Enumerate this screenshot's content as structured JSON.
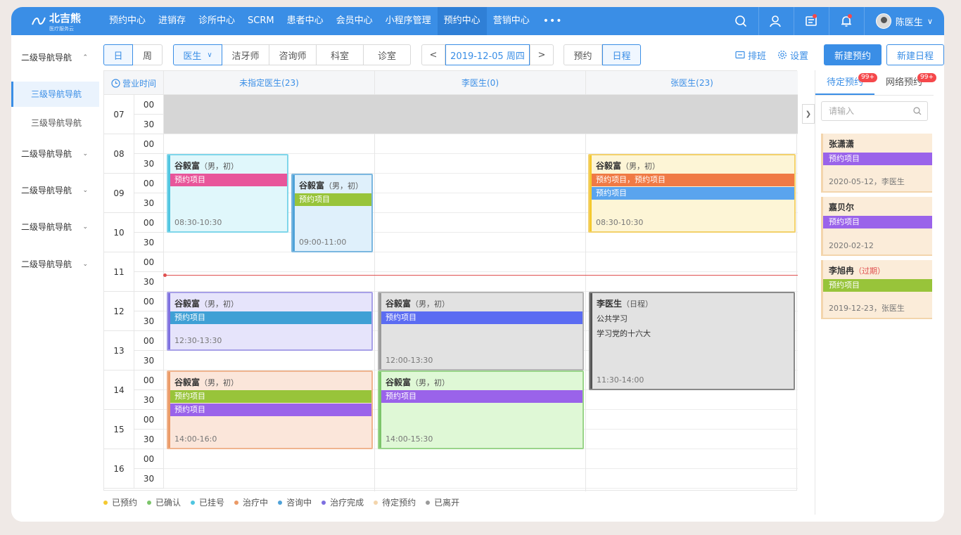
{
  "brand": {
    "name": "北吉熊",
    "sub": "医疗服务云"
  },
  "nav": [
    "预约中心",
    "进销存",
    "诊所中心",
    "SCRM",
    "患者中心",
    "会员中心",
    "小程序管理",
    "预约中心",
    "营销中心"
  ],
  "nav_active_index": 7,
  "nav_more": "•••",
  "user": {
    "name": "陈医生"
  },
  "sidebar": {
    "items": [
      {
        "label": "二级导航导航",
        "chevron": "⌃"
      },
      {
        "label": "三级导航导航",
        "active": true
      },
      {
        "label": "三级导航导航"
      },
      {
        "label": "二级导航导航",
        "chevron": "⌄"
      },
      {
        "label": "二级导航导航",
        "chevron": "⌄"
      },
      {
        "label": "二级导航导航",
        "chevron": "⌄"
      },
      {
        "label": "二级导航导航",
        "chevron": "⌄"
      }
    ]
  },
  "toolbar": {
    "view_day": "日",
    "view_week": "周",
    "role_select": "医生",
    "role_tabs": [
      "洁牙师",
      "咨询师",
      "科室",
      "诊室"
    ],
    "prev": "<",
    "date": "2019-12-05 周四",
    "next": ">",
    "mode_appt": "预约",
    "mode_schedule": "日程",
    "shift": "排班",
    "settings": "设置",
    "new_appt": "新建预约",
    "new_schedule": "新建日程"
  },
  "calendar": {
    "time_header": "营业时间",
    "columns": [
      "未指定医生(23)",
      "李医生(0)",
      "张医生(23)"
    ],
    "hours": [
      "07",
      "08",
      "09",
      "10",
      "11",
      "12",
      "13",
      "14",
      "15",
      "16"
    ],
    "minutes": [
      "00",
      "30"
    ]
  },
  "appointments": [
    {
      "name": "谷毅富",
      "meta": "（男，初）",
      "tags": [
        {
          "text": "预约项目",
          "color": "#e8559a"
        }
      ],
      "time": "08:30-10:30",
      "bg": "#e0f7fb",
      "border": "#7fd6ea",
      "bar": "#4fc5e0"
    },
    {
      "name": "谷毅富",
      "meta": "（男，初）",
      "tags": [
        {
          "text": "预约项目",
          "color": "#98c43a"
        }
      ],
      "time": "09:00-11:00",
      "bg": "#dff0fb",
      "border": "#7ab7e0",
      "bar": "#4fa2d8"
    },
    {
      "name": "谷毅富",
      "meta": "（男，初）",
      "tags": [
        {
          "text": "预约项目，预约项目",
          "color": "#f07a45"
        },
        {
          "text": "预约项目",
          "color": "#5aa4ee"
        }
      ],
      "time": "08:30-10:30",
      "bg": "#fdf5d6",
      "border": "#f3d16b",
      "bar": "#f4c930"
    },
    {
      "name": "谷毅富",
      "meta": "（男，初）",
      "tags": [
        {
          "text": "预约项目",
          "color": "#3fa0d5"
        }
      ],
      "time": "12:30-13:30",
      "bg": "#e6e4fb",
      "border": "#a7a0e8",
      "bar": "#7d6fe0"
    },
    {
      "name": "谷毅富",
      "meta": "（男，初）",
      "tags": [
        {
          "text": "预约项目",
          "color": "#5b6cf2"
        }
      ],
      "time": "12:00-13:30",
      "bg": "#e2e2e2",
      "border": "#b5b5b5",
      "bar": "#9a9a9a"
    },
    {
      "name": "李医生",
      "meta": "（日程）",
      "notes": [
        "公共学习",
        "学习党的十六大"
      ],
      "time": "11:30-14:00",
      "bg": "#e2e2e2",
      "border": "#8a8a8a",
      "bar": "#555555"
    },
    {
      "name": "谷毅富",
      "meta": "（男，初）",
      "tags": [
        {
          "text": "预约项目",
          "color": "#98c43a"
        },
        {
          "text": "预约项目",
          "color": "#9a63ea"
        }
      ],
      "time": "14:00-16:0",
      "bg": "#fbe6da",
      "border": "#f0b48e",
      "bar": "#eb9a66"
    },
    {
      "name": "谷毅富",
      "meta": "（男，初）",
      "tags": [
        {
          "text": "预约项目",
          "color": "#9a63ea"
        }
      ],
      "time": "14:00-15:30",
      "bg": "#dff8d6",
      "border": "#9ad58a",
      "bar": "#7cc56a"
    }
  ],
  "legend": [
    {
      "label": "已预约",
      "color": "#f4c930"
    },
    {
      "label": "已确认",
      "color": "#7cc56a"
    },
    {
      "label": "已挂号",
      "color": "#4fc5e0"
    },
    {
      "label": "治疗中",
      "color": "#eb9a66"
    },
    {
      "label": "咨询中",
      "color": "#4fa2d8"
    },
    {
      "label": "治疗完成",
      "color": "#7d6fe0"
    },
    {
      "label": "待定预约",
      "color": "#f3d5ac"
    },
    {
      "label": "已离开",
      "color": "#9a9a9a"
    }
  ],
  "right_panel": {
    "tabs": [
      {
        "label": "待定预约",
        "badge": "99+"
      },
      {
        "label": "网络预约",
        "badge": "99+"
      }
    ],
    "search_placeholder": "请输入",
    "cards": [
      {
        "name": "张潇潇",
        "tag": "预约项目",
        "tag_color": "#9a63ea",
        "footer": "2020-05-12，李医生"
      },
      {
        "name": "嘉贝尔",
        "tag": "预约项目",
        "tag_color": "#9a63ea",
        "footer": "2020-02-12"
      },
      {
        "name": "李旭冉",
        "expired": "（过期）",
        "tag": "预约项目",
        "tag_color": "#98c43a",
        "footer": "2019-12-23，张医生"
      }
    ]
  }
}
